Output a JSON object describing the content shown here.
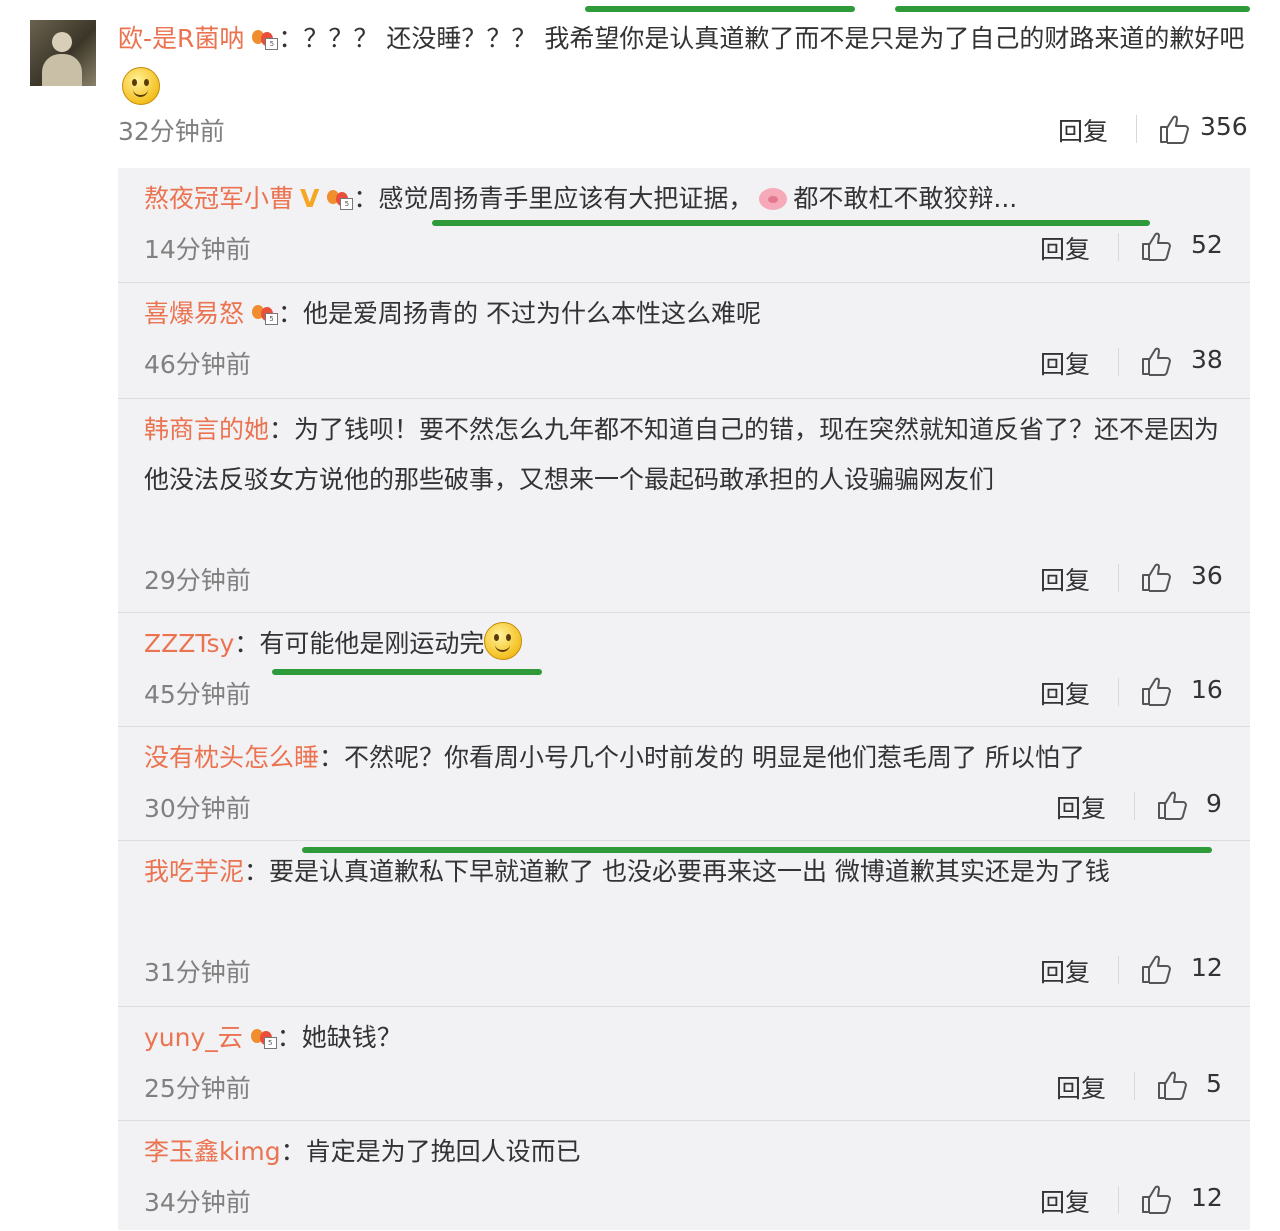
{
  "main": {
    "username": "欧-是R菌呐",
    "sep": "：",
    "text": "？？？ 还没睡？？？ 我希望你是认真道歉了而不是只是为了自己的财路来道的歉好吧",
    "time": "32分钟前",
    "reply_label": "回复",
    "likes": "356"
  },
  "replies": [
    {
      "username": "熬夜冠军小曹",
      "sep": "：",
      "text_a": "感觉周扬青手里应该有大把证据，",
      "text_b": "都不敢杠不敢狡辩...",
      "time": "14分钟前",
      "reply_label": "回复",
      "likes": "52"
    },
    {
      "username": "喜爆易怒",
      "sep": "：",
      "text": "他是爱周扬青的 不过为什么本性这么难呢",
      "time": "46分钟前",
      "reply_label": "回复",
      "likes": "38"
    },
    {
      "username": "韩商言的她",
      "sep": "：",
      "text": "为了钱呗！要不然怎么九年都不知道自己的错，现在突然就知道反省了？还不是因为他没法反驳女方说他的那些破事，又想来一个最起码敢承担的人设骗骗网友们",
      "time": "29分钟前",
      "reply_label": "回复",
      "likes": "36"
    },
    {
      "username": "ZZZTsy",
      "sep": "：",
      "text": "有可能他是刚运动完",
      "time": "45分钟前",
      "reply_label": "回复",
      "likes": "16"
    },
    {
      "username": "没有枕头怎么睡",
      "sep": "：",
      "text": "不然呢？你看周小号几个小时前发的 明显是他们惹毛周了 所以怕了",
      "time": "30分钟前",
      "reply_label": "回复",
      "likes": "9"
    },
    {
      "username": "我吃芋泥",
      "sep": "：",
      "text": "要是认真道歉私下早就道歉了 也没必要再来这一出 微博道歉其实还是为了钱",
      "time": "31分钟前",
      "reply_label": "回复",
      "likes": "12"
    },
    {
      "username": "yuny_云",
      "sep": "：",
      "text": "她缺钱？",
      "time": "25分钟前",
      "reply_label": "回复",
      "likes": "5"
    },
    {
      "username": "李玉鑫kimg",
      "sep": "：",
      "text": "肯定是为了挽回人设而已",
      "time": "34分钟前",
      "reply_label": "回复",
      "likes": "12"
    }
  ],
  "colors": {
    "username": "#eb7350",
    "highlight": "#2e9a3a",
    "reply_bg": "#f2f2f5"
  }
}
